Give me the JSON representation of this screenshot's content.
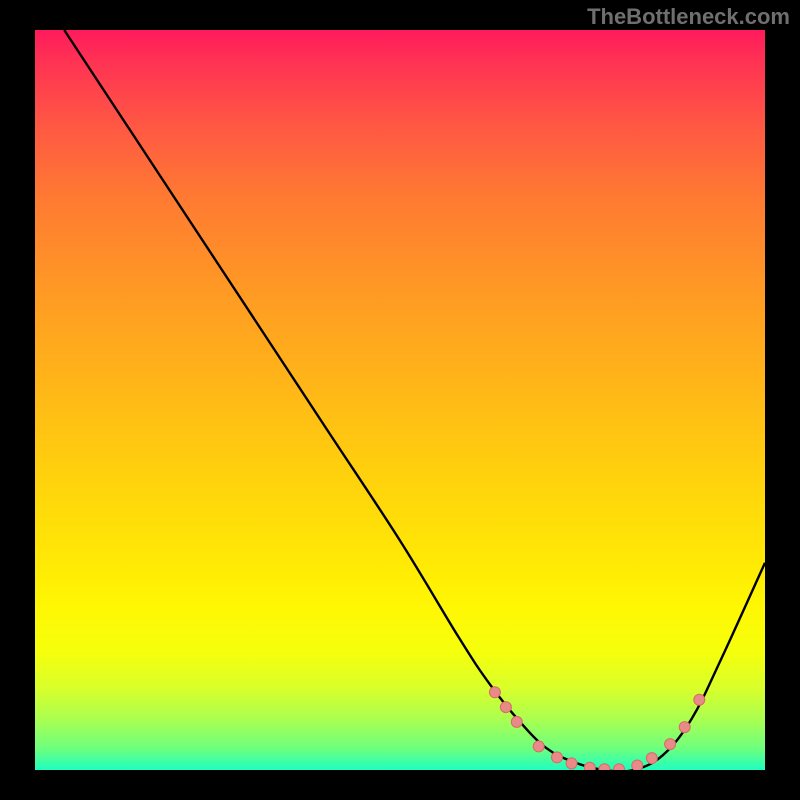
{
  "watermark": "TheBottleneck.com",
  "colors": {
    "background": "#000000",
    "watermark_text": "#6f6f6f",
    "curve_stroke": "#000000",
    "dot_stroke": "#d96a66",
    "dot_fill": "#e88a87"
  },
  "chart_data": {
    "type": "line",
    "title": "",
    "xlabel": "",
    "ylabel": "",
    "xlim": [
      0,
      100
    ],
    "ylim": [
      0,
      100
    ],
    "x": [
      4,
      10,
      20,
      30,
      40,
      50,
      58,
      62,
      66,
      70,
      74,
      78,
      82,
      86,
      90,
      94,
      100
    ],
    "values": [
      100,
      91,
      76,
      61,
      46,
      31,
      18,
      12,
      7,
      3,
      1,
      0,
      0,
      2,
      7,
      15,
      28
    ],
    "minimum_x": 79,
    "dots": [
      {
        "x": 63.0,
        "y": 10.5
      },
      {
        "x": 64.5,
        "y": 8.5
      },
      {
        "x": 66.0,
        "y": 6.5
      },
      {
        "x": 69.0,
        "y": 3.2
      },
      {
        "x": 71.5,
        "y": 1.7
      },
      {
        "x": 73.5,
        "y": 0.9
      },
      {
        "x": 76.0,
        "y": 0.3
      },
      {
        "x": 78.0,
        "y": 0.1
      },
      {
        "x": 80.0,
        "y": 0.1
      },
      {
        "x": 82.5,
        "y": 0.6
      },
      {
        "x": 84.5,
        "y": 1.6
      },
      {
        "x": 87.0,
        "y": 3.5
      },
      {
        "x": 89.0,
        "y": 5.8
      },
      {
        "x": 91.0,
        "y": 9.5
      }
    ]
  }
}
